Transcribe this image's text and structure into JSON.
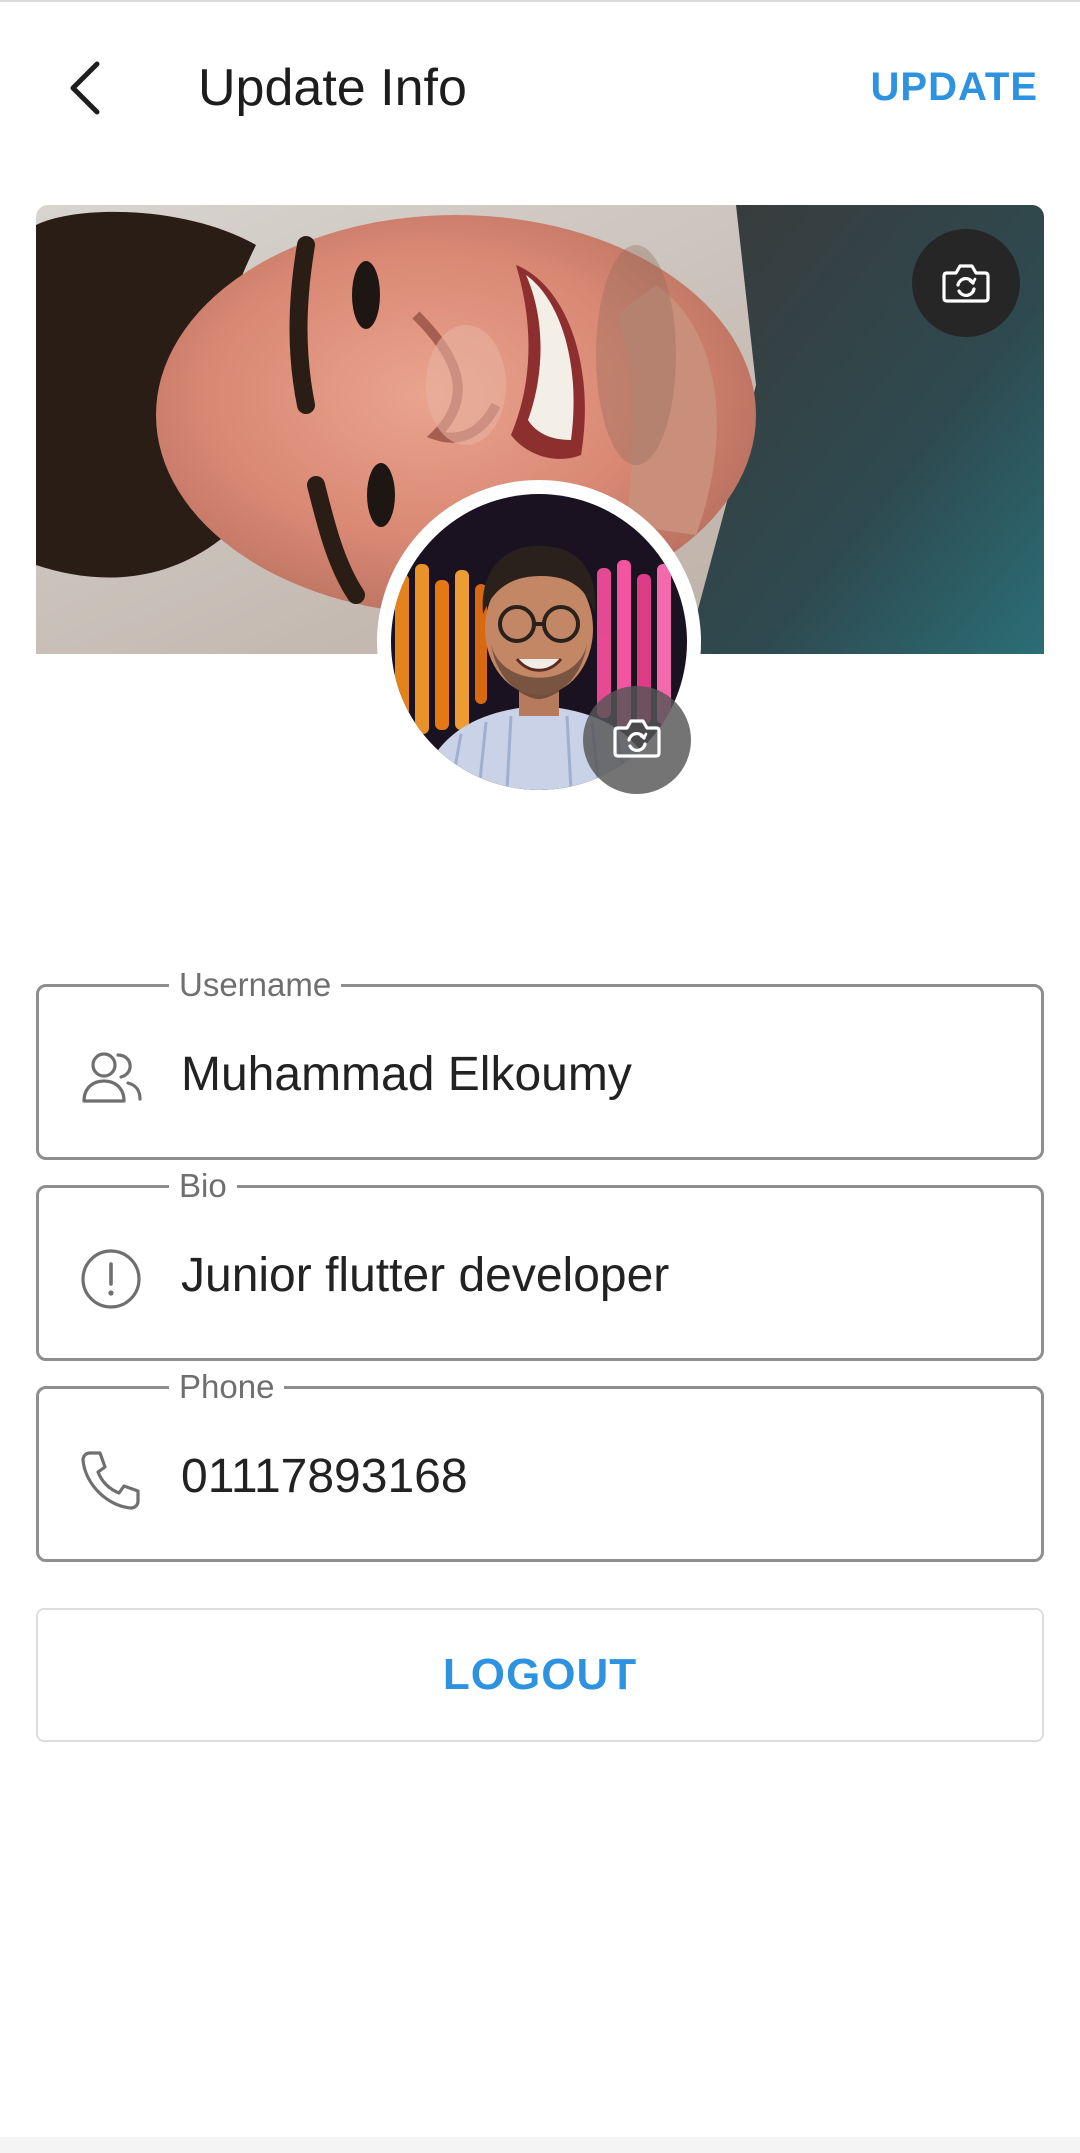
{
  "header": {
    "title": "Update Info",
    "update_label": "UPDATE",
    "back_icon": "chevron-left-icon"
  },
  "cover_photo": {
    "camera_icon": "camera-icon"
  },
  "avatar": {
    "camera_icon": "camera-icon"
  },
  "form": {
    "username": {
      "label": "Username",
      "value": "Muhammad Elkoumy",
      "icon": "users-icon"
    },
    "bio": {
      "label": "Bio",
      "value": "Junior flutter developer",
      "icon": "info-circle-icon"
    },
    "phone": {
      "label": "Phone",
      "value": "01117893168",
      "icon": "phone-icon"
    }
  },
  "logout_label": "LOGOUT",
  "colors": {
    "accent": "#2d93e0",
    "field_border": "#8e8e8e",
    "label": "#6f6f6f",
    "camera_button": "#262626"
  }
}
